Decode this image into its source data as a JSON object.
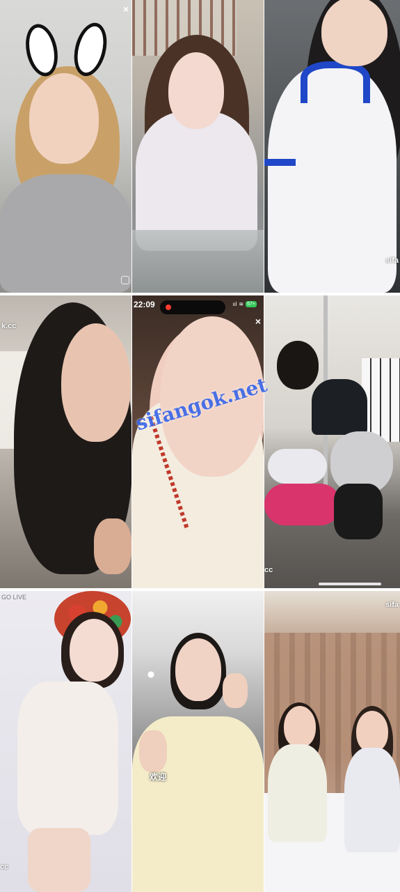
{
  "tiles": {
    "r1c1": {
      "close_glyph": "×"
    },
    "r1c3": {
      "watermark": "sifa"
    },
    "r2c1": {
      "watermark": "k.cc"
    },
    "r2c2": {
      "time": "22:09",
      "battery": "67+",
      "signal": "ııl",
      "wifi": "≋",
      "close_glyph": "×",
      "watermark": "sifangok.net"
    },
    "r2c3": {
      "watermark": "cc"
    },
    "r3c1": {
      "header": "GO LIVE",
      "watermark": "cc"
    },
    "r3c2": {
      "caption": "欢迎"
    },
    "r3c3": {
      "watermark": "sifa"
    }
  },
  "colors": {
    "watermark_blue": "#3b67e8",
    "record_red": "#ff3b30",
    "battery_green": "#34c759"
  }
}
